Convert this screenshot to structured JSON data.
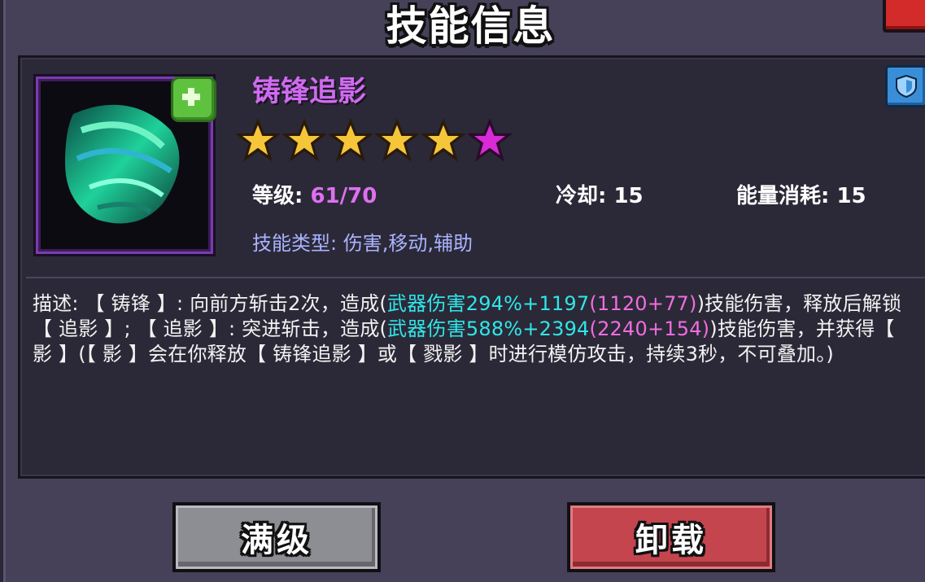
{
  "window": {
    "title": "技能信息"
  },
  "skill": {
    "name": "铸锋追影",
    "stars": {
      "gold": 5,
      "purple": 1
    },
    "level_label": "等级: ",
    "level_value": "61/70",
    "cooldown_label": "冷却: ",
    "cooldown_value": "15",
    "energy_label": "能量消耗: ",
    "energy_value": "15",
    "type_label": "技能类型: ",
    "type_value": "伤害,移动,辅助",
    "icon": "green-blade-swirl-icon"
  },
  "description": {
    "p1": "描述: 【 铸锋 】: 向前方斩击2次，造成(",
    "hl1": "武器伤害294%+1197",
    "p2": "(1120+77)",
    "p3": ")技能伤害，释放后解锁【 追影 】; 【 追影 】: 突进斩击，造成(",
    "hl3": "武器伤害588%+2394",
    "p4": "(2240+154)",
    "p5": ")技能伤害，并获得【 影 】(【 影 】会在你释放【 铸锋追影 】或【 戮影 】时进行模仿攻击，持续3秒，不可叠加。)"
  },
  "buttons": {
    "max_label": "满级",
    "unequip_label": "卸载"
  },
  "colors": {
    "skill_name": "#d06bf1",
    "highlight_cyan": "#30e6e8",
    "highlight_pink": "#f06de0"
  }
}
